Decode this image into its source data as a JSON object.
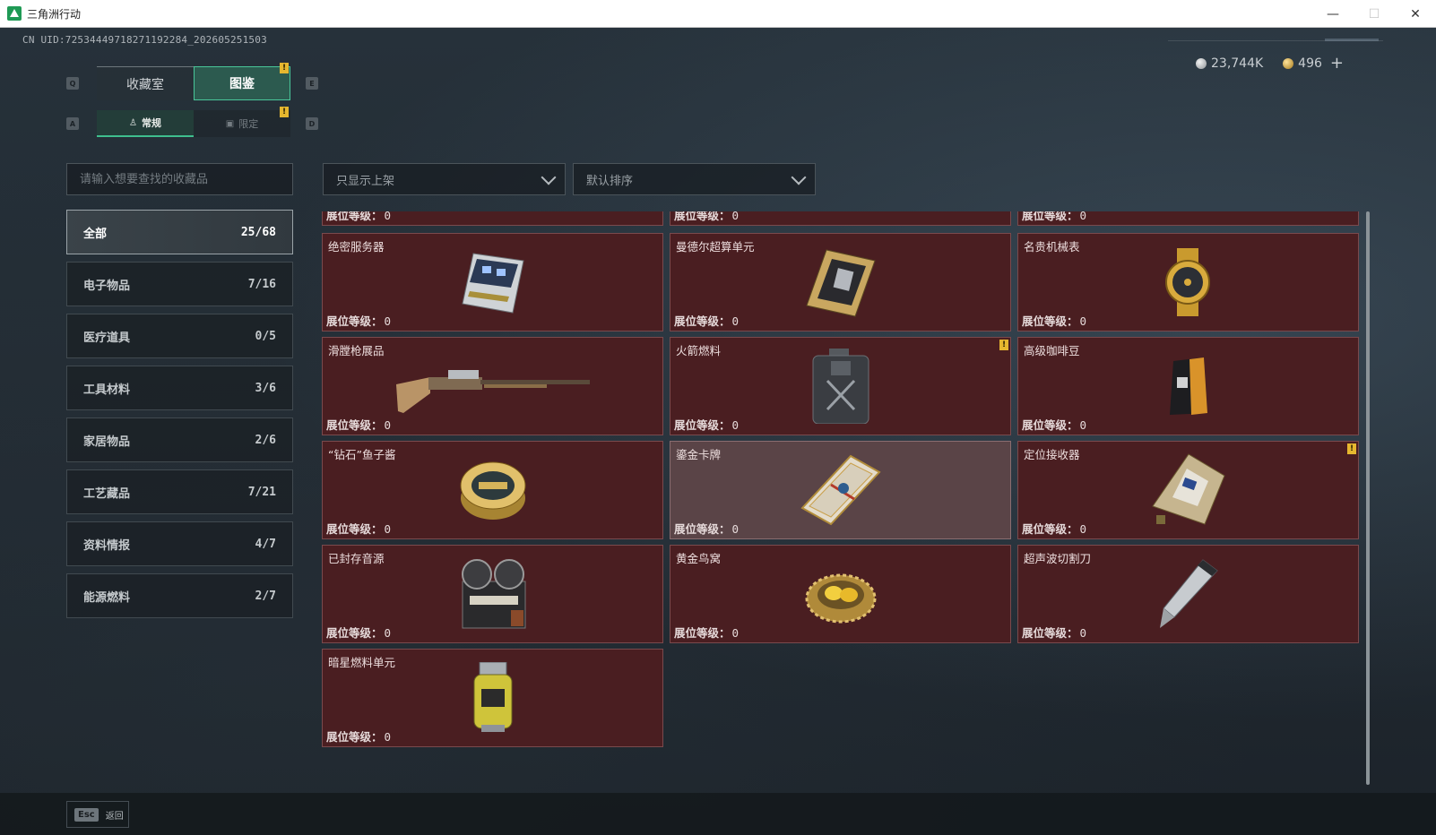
{
  "window": {
    "title": "三角洲行动",
    "minimize": "—",
    "maximize": "☐",
    "close": "✕"
  },
  "header": {
    "uid": "CN UID:7253444971827119228​4_202605251503",
    "currency_silver": "23,744K",
    "currency_gold": "496",
    "add_label": "+"
  },
  "tabs": {
    "main": [
      {
        "label": "收藏室",
        "key": "Q"
      },
      {
        "label": "图鉴",
        "key": "E",
        "badge": "!"
      }
    ],
    "sub": [
      {
        "label": "常规",
        "key": "A"
      },
      {
        "label": "限定",
        "key": "D",
        "badge": "!"
      }
    ]
  },
  "search": {
    "placeholder": "请输入想要查找的收藏品"
  },
  "filters": {
    "shelf": "只显示上架",
    "sort": "默认排序"
  },
  "categories": [
    {
      "label": "全部",
      "count": "25/68"
    },
    {
      "label": "电子物品",
      "count": "7/16"
    },
    {
      "label": "医疗道具",
      "count": "0/5"
    },
    {
      "label": "工具材料",
      "count": "3/6"
    },
    {
      "label": "家居物品",
      "count": "2/6"
    },
    {
      "label": "工艺藏品",
      "count": "7/21"
    },
    {
      "label": "资料情报",
      "count": "4/7"
    },
    {
      "label": "能源燃料",
      "count": "2/7"
    }
  ],
  "level_label": "展位等级：",
  "items": [
    {
      "name": "",
      "level": "0",
      "icon": "hidden-item"
    },
    {
      "name": "",
      "level": "0",
      "icon": "hidden-item"
    },
    {
      "name": "",
      "level": "0",
      "icon": "hidden-item"
    },
    {
      "name": "绝密服务器",
      "level": "0",
      "icon": "server-icon"
    },
    {
      "name": "曼德尔超算单元",
      "level": "0",
      "icon": "supercomputer-unit-icon"
    },
    {
      "name": "名贵机械表",
      "level": "0",
      "icon": "watch-icon"
    },
    {
      "name": "滑膛枪展品",
      "level": "0",
      "icon": "musket-icon"
    },
    {
      "name": "火箭燃料",
      "level": "0",
      "icon": "fuel-can-icon",
      "badge": "!"
    },
    {
      "name": "高级咖啡豆",
      "level": "0",
      "icon": "coffee-bag-icon"
    },
    {
      "name": "“钻石”鱼子酱",
      "level": "0",
      "icon": "caviar-tin-icon"
    },
    {
      "name": "鎏金卡牌",
      "level": "0",
      "icon": "gilded-card-icon"
    },
    {
      "name": "定位接收器",
      "level": "0",
      "icon": "receiver-icon",
      "badge": "!"
    },
    {
      "name": "已封存音源",
      "level": "0",
      "icon": "reel-recorder-icon"
    },
    {
      "name": "黄金鸟窝",
      "level": "0",
      "icon": "golden-nest-icon"
    },
    {
      "name": "超声波切割刀",
      "level": "0",
      "icon": "cutter-icon"
    },
    {
      "name": "暗星燃料单元",
      "level": "0",
      "icon": "fuel-cell-icon"
    }
  ],
  "footer": {
    "esc_key": "Esc",
    "esc_label": "返回"
  }
}
